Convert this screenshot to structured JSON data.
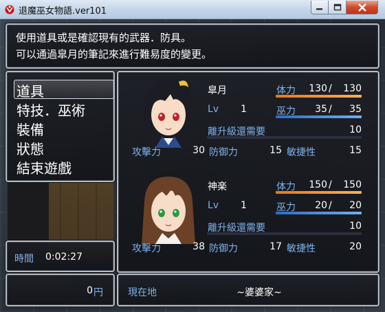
{
  "window": {
    "title": "退魔巫女物語.ver101"
  },
  "help": {
    "line1": "使用道具或是確認現有的武器．防具。",
    "line2": "可以通過皐月的筆記來進行難易度的變更。"
  },
  "menu": {
    "items": [
      "道具",
      "特技．巫術",
      "裝備",
      "狀態",
      "結束遊戲"
    ]
  },
  "playtime": {
    "label": "時間",
    "value": "0:02:27"
  },
  "gold": {
    "value": "0",
    "unit": "円"
  },
  "location": {
    "label": "現在地",
    "value": "~婆婆家~"
  },
  "labels": {
    "hp": "体力",
    "mp": "巫力",
    "lv": "Lv",
    "exp": "離升級還需要",
    "atk": "攻擊力",
    "def": "防御力",
    "agi": "敏捷性",
    "slash": "/"
  },
  "actors": [
    {
      "name": "皐月",
      "lv": "1",
      "hp": "130",
      "mhp": "130",
      "hp_fraction": 1.0,
      "mp": "35",
      "mmp": "35",
      "mp_fraction": 1.0,
      "exp": "10",
      "atk": "30",
      "def": "15",
      "agi": "15",
      "hair_color": "#1c1c24",
      "eye_color": "#c0202a"
    },
    {
      "name": "神楽",
      "lv": "1",
      "hp": "150",
      "mhp": "150",
      "hp_fraction": 1.0,
      "mp": "20",
      "mmp": "20",
      "mp_fraction": 1.0,
      "exp": "10",
      "atk": "38",
      "def": "17",
      "agi": "20",
      "hair_color": "#6b4128",
      "eye_color": "#2a9a3c"
    }
  ]
}
